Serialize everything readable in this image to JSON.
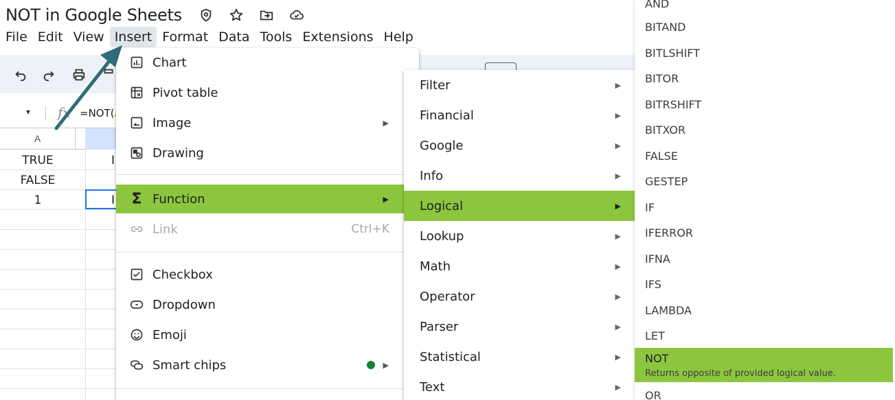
{
  "document": {
    "title": "NOT in Google Sheets"
  },
  "title_icons": [
    "shield-icon",
    "star-icon",
    "move-to-folder-icon",
    "cloud-saved-icon"
  ],
  "menubar": [
    "File",
    "Edit",
    "View",
    "Insert",
    "Format",
    "Data",
    "Tools",
    "Extensions",
    "Help"
  ],
  "formula_bar": {
    "name_box_arrow": "▾",
    "fx": "fx",
    "formula_prefix": "=NOT(",
    "formula_suffix": "A"
  },
  "grid": {
    "col_a": "A",
    "cells": [
      "TRUE",
      "FALSE",
      "1"
    ],
    "col_b_partial": [
      "I",
      "",
      "I"
    ]
  },
  "insert_menu": {
    "items": [
      {
        "label": "Chart",
        "icon": "chart-icon"
      },
      {
        "label": "Pivot table",
        "icon": "pivot-table-icon"
      },
      {
        "label": "Image",
        "icon": "image-icon",
        "submenu": "▶"
      },
      {
        "label": "Drawing",
        "icon": "drawing-icon"
      },
      {
        "label": "Function",
        "icon": "sigma-icon",
        "submenu": "▶",
        "highlighted": true
      },
      {
        "label": "Link",
        "icon": "link-icon",
        "shortcut": "Ctrl+K",
        "disabled": true
      },
      {
        "label": "Checkbox",
        "icon": "checkbox-icon"
      },
      {
        "label": "Dropdown",
        "icon": "dropdown-icon"
      },
      {
        "label": "Emoji",
        "icon": "emoji-icon"
      },
      {
        "label": "Smart chips",
        "icon": "smart-chips-icon",
        "submenu": "▶",
        "new_dot_color": "#188038"
      }
    ]
  },
  "function_menu": {
    "items": [
      "Filter",
      "Financial",
      "Google",
      "Info",
      "Logical",
      "Lookup",
      "Math",
      "Operator",
      "Parser",
      "Statistical",
      "Text"
    ],
    "highlighted": "Logical",
    "arrow": "▶"
  },
  "logical_menu": {
    "items": [
      "AND",
      "BITAND",
      "BITLSHIFT",
      "BITOR",
      "BITRSHIFT",
      "BITXOR",
      "FALSE",
      "GESTEP",
      "IF",
      "IFERROR",
      "IFNA",
      "IFS",
      "LAMBDA",
      "LET"
    ],
    "highlighted": {
      "label": "NOT",
      "description": "Returns opposite of provided logical value."
    },
    "after": [
      "OR"
    ]
  },
  "colors": {
    "highlight": "#8cc63f",
    "toolbar_bg": "#eef2f8",
    "arrow_annotation": "#2f6b78"
  }
}
